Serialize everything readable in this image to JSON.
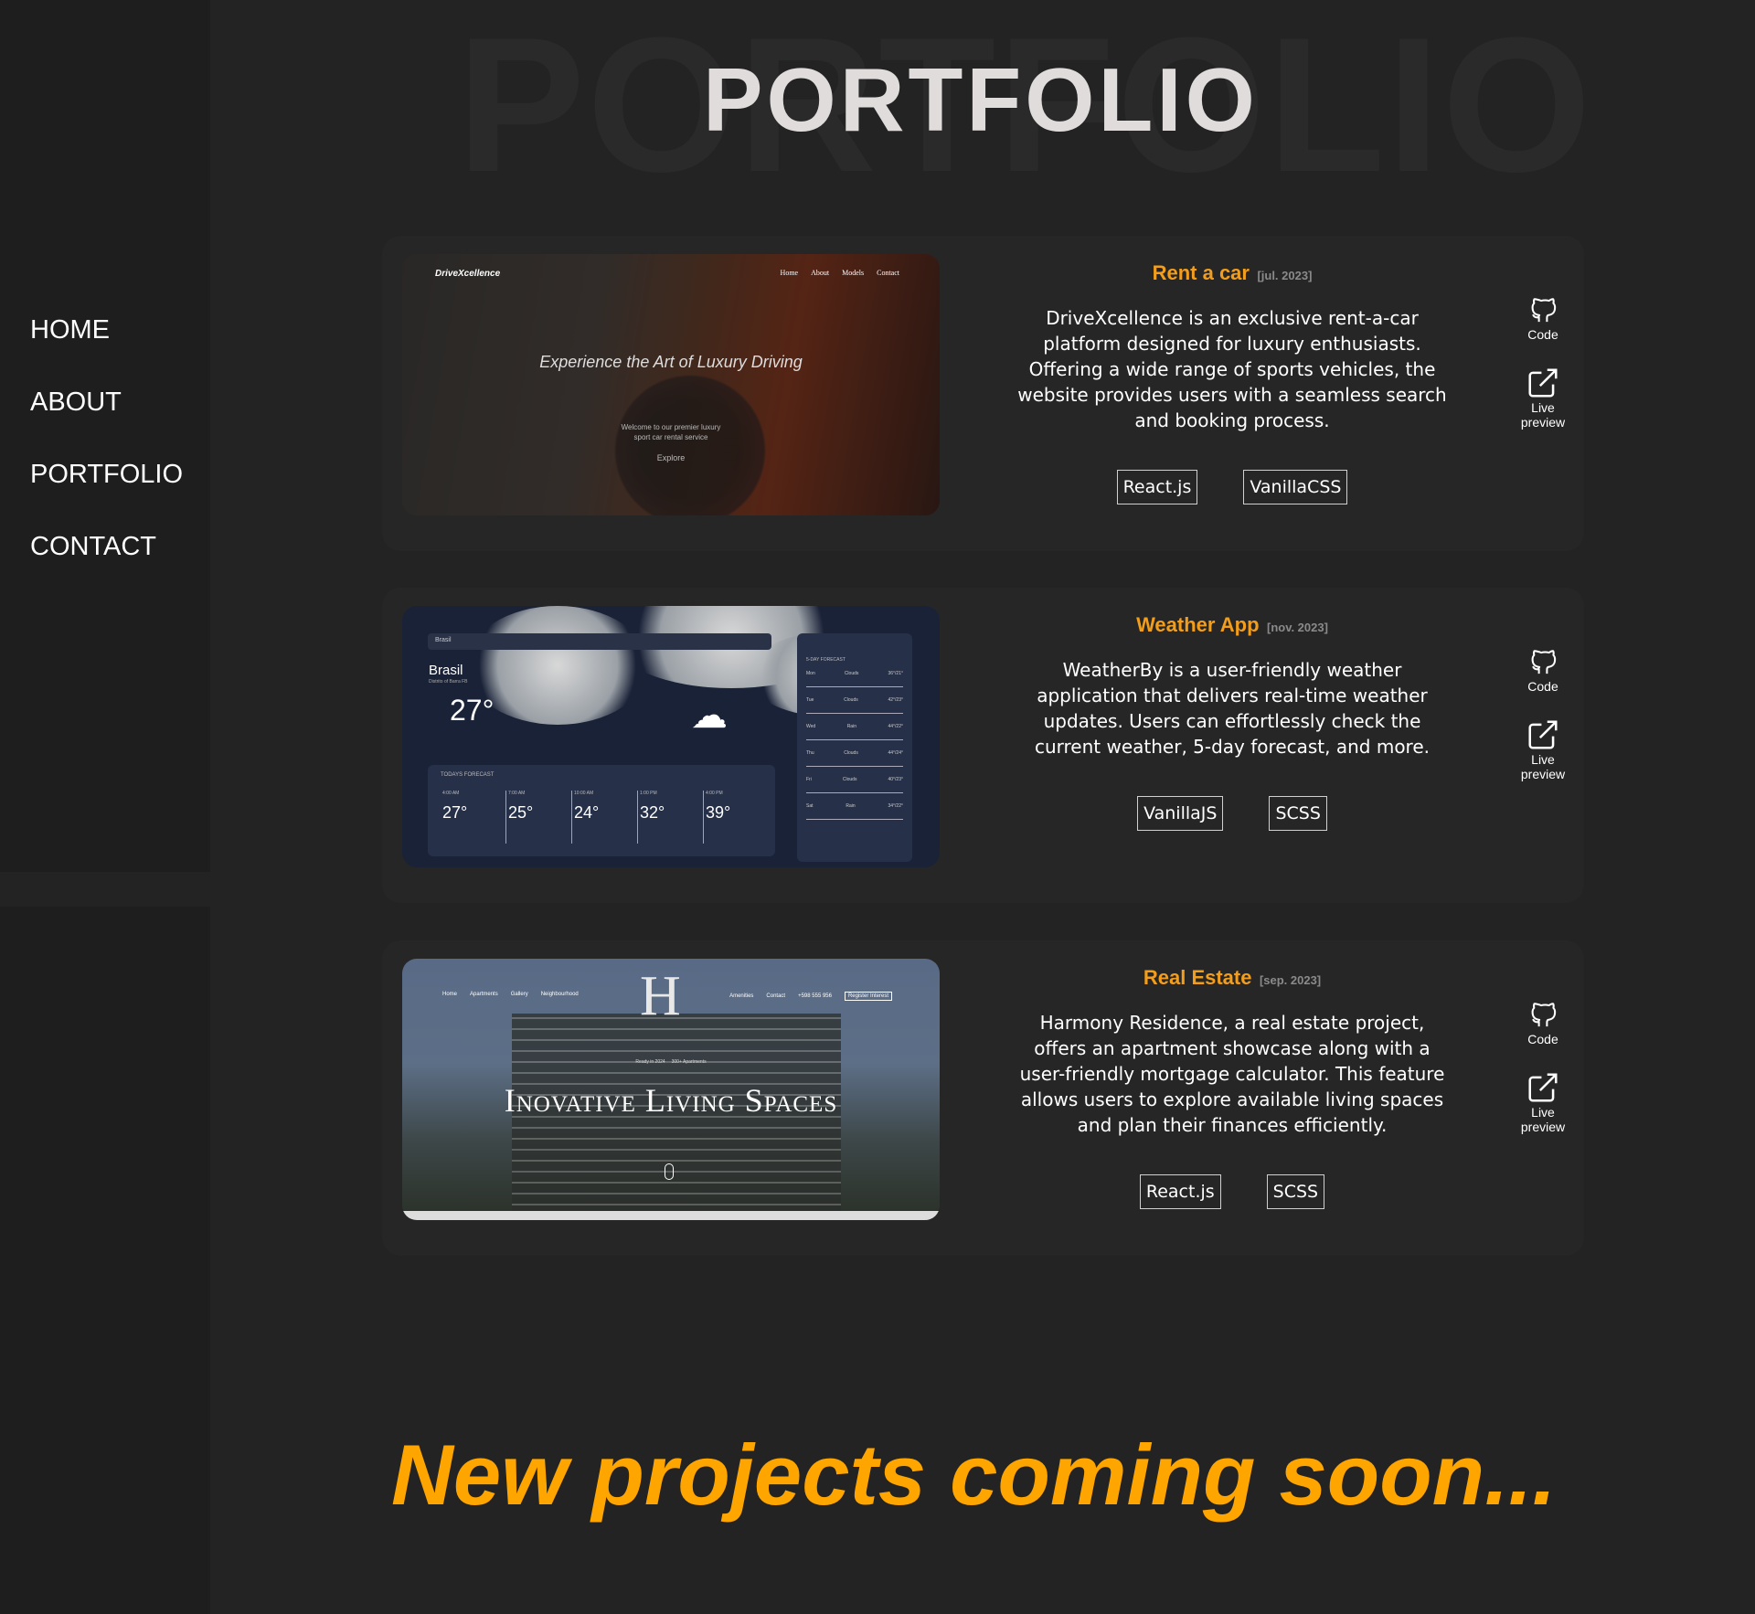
{
  "nav": {
    "items": [
      "HOME",
      "ABOUT",
      "PORTFOLIO",
      "CONTACT"
    ]
  },
  "header": {
    "title": "PORTFOLIO",
    "background_title": "PORTFOLIO"
  },
  "links": {
    "code_label": "Code",
    "preview_label_1": "Live",
    "preview_label_2": "preview"
  },
  "projects": [
    {
      "title": "Rent a car",
      "date": "[jul. 2023]",
      "description": "DriveXcellence is an exclusive rent-a-car platform designed for luxury enthusiasts. Offering a wide range of sports vehicles, the website provides users with a seamless search and booking process.",
      "tags": [
        "React.js",
        "VanillaCSS"
      ],
      "preview": {
        "logo": "DriveXcellence",
        "nav": [
          "Home",
          "About",
          "Models",
          "Contact"
        ],
        "hero": "Experience the Art of Luxury Driving",
        "sub_1": "Welcome to our premier luxury",
        "sub_2": "sport car rental service",
        "button": "Explore"
      }
    },
    {
      "title": "Weather App",
      "date": "[nov. 2023]",
      "description": "WeatherBy is a user-friendly weather application that delivers real-time weather updates. Users can effortlessly check the current weather, 5-day forecast, and more.",
      "tags": [
        "VanillaJS",
        "SCSS"
      ],
      "preview": {
        "search": "Brasil",
        "city": "Brasil",
        "city_full": "Distrito of Barra FB",
        "temp": "27°",
        "today_label": "TODAYS FORECAST",
        "hours": [
          {
            "time": "4:00 AM",
            "temp": "27°"
          },
          {
            "time": "7:00 AM",
            "temp": "25°"
          },
          {
            "time": "10:00 AM",
            "temp": "24°"
          },
          {
            "time": "1:00 PM",
            "temp": "32°"
          },
          {
            "time": "4:00 PM",
            "temp": "39°"
          }
        ],
        "week_label": "5-DAY FORECAST",
        "days": [
          {
            "day": "Mon",
            "cond": "Clouds",
            "range": "36°/21°"
          },
          {
            "day": "Tue",
            "cond": "Clouds",
            "range": "42°/23°"
          },
          {
            "day": "Wed",
            "cond": "Rain",
            "range": "44°/22°"
          },
          {
            "day": "Thu",
            "cond": "Clouds",
            "range": "44°/24°"
          },
          {
            "day": "Fri",
            "cond": "Clouds",
            "range": "40°/23°"
          },
          {
            "day": "Sat",
            "cond": "Rain",
            "range": "34°/22°"
          }
        ]
      }
    },
    {
      "title": "Real Estate",
      "date": "[sep. 2023]",
      "description": "Harmony Residence, a real estate project, offers an apartment showcase along with a user-friendly mortgage calculator. This feature allows users to explore available living spaces and plan their finances efficiently.",
      "tags": [
        "React.js",
        "SCSS"
      ],
      "preview": {
        "nav_left": [
          "Home",
          "Apartments",
          "Gallery",
          "Neighbourhood"
        ],
        "nav_right": [
          "Amenities",
          "Contact",
          "+598 555 956"
        ],
        "register": "Register Interest",
        "logo": "H",
        "small_left": "Ready in 2024",
        "small_right": "300+ Apartments",
        "hero": "Inovative Living Spaces"
      }
    }
  ],
  "footer": {
    "coming_soon": "New projects coming soon..."
  },
  "colors": {
    "accent": "#ffa500",
    "project_title": "#f29e1c",
    "background": "#232323",
    "sidebar": "#1e1e1e",
    "card": "#262626"
  }
}
